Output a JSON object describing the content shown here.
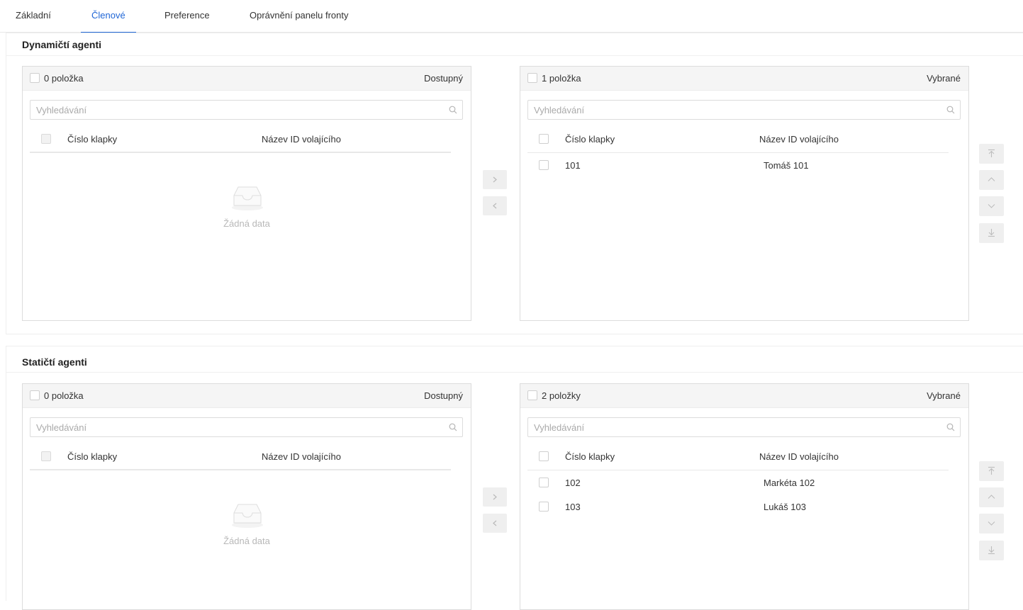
{
  "tabs": [
    {
      "label": "Základní",
      "active": false
    },
    {
      "label": "Členové",
      "active": true
    },
    {
      "label": "Preference",
      "active": false
    },
    {
      "label": "Oprávnění panelu fronty",
      "active": false
    }
  ],
  "accent_color": "#1f66d6",
  "dynamic": {
    "title": "Dynamičtí agenti",
    "available": {
      "count_label": "0 položka",
      "type_label": "Dostupný",
      "search_placeholder": "Vyhledávání",
      "columns": [
        "Číslo klapky",
        "Název ID volajícího"
      ],
      "empty_text": "Žádná data",
      "rows": []
    },
    "selected": {
      "count_label": "1 položka",
      "type_label": "Vybrané",
      "search_placeholder": "Vyhledávání",
      "columns": [
        "Číslo klapky",
        "Název ID volajícího"
      ],
      "rows": [
        {
          "ext": "101",
          "name": "Tomáš 101"
        }
      ]
    }
  },
  "static": {
    "title": "Statičtí agenti",
    "available": {
      "count_label": "0 položka",
      "type_label": "Dostupný",
      "search_placeholder": "Vyhledávání",
      "columns": [
        "Číslo klapky",
        "Název ID volajícího"
      ],
      "empty_text": "Žádná data",
      "rows": []
    },
    "selected": {
      "count_label": "2 položky",
      "type_label": "Vybrané",
      "search_placeholder": "Vyhledávání",
      "columns": [
        "Číslo klapky",
        "Název ID volajícího"
      ],
      "rows": [
        {
          "ext": "102",
          "name": "Markéta 102"
        },
        {
          "ext": "103",
          "name": "Lukáš 103"
        }
      ]
    }
  },
  "icons": {
    "search": "search-icon",
    "empty": "inbox-icon",
    "move_right": "chevron-right-icon",
    "move_left": "chevron-left-icon",
    "move_top": "arrow-to-top-icon",
    "move_up": "chevron-up-icon",
    "move_down": "chevron-down-icon",
    "move_bottom": "arrow-to-bottom-icon"
  }
}
